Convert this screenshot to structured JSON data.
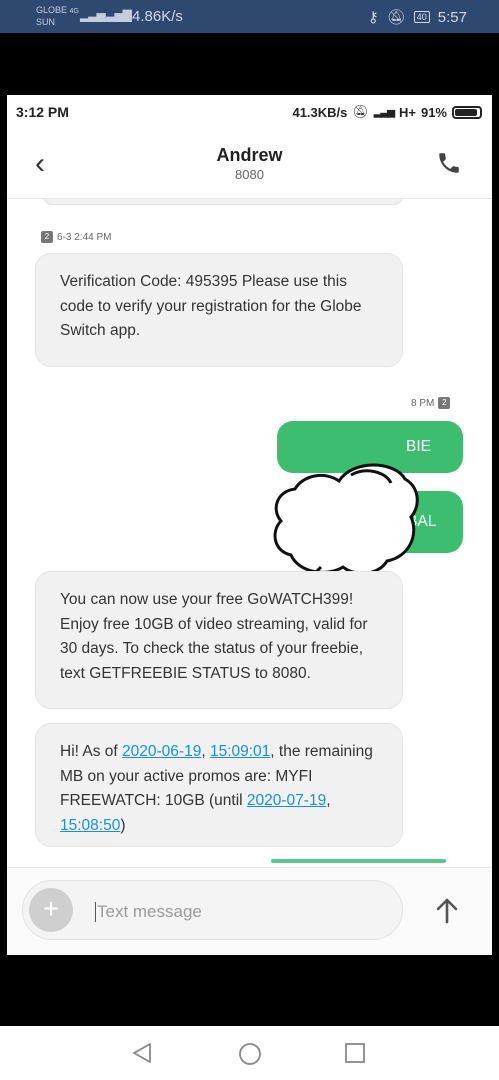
{
  "outer_status": {
    "carrier_line1": "GLOBE",
    "carrier_line2": "SUN",
    "net_type": "4G",
    "speed": "4.86K/s",
    "battery": "40",
    "time": "5:57"
  },
  "inner_status": {
    "time": "3:12 PM",
    "speed": "41.3KB/s",
    "network": "H+",
    "battery": "91%"
  },
  "header": {
    "contact_name": "Andrew",
    "contact_number": "8080"
  },
  "messages": [
    {
      "direction": "incoming",
      "sim": "2",
      "timestamp": "6-3 2:44 PM",
      "text": "Verification Code: 495395 Please use this code to verify your registration for the Globe Switch app."
    },
    {
      "direction": "outgoing",
      "sim": "2",
      "timestamp_partial": "8 PM",
      "text_partial": "BIE"
    },
    {
      "direction": "outgoing",
      "text": "DATA BAL"
    },
    {
      "direction": "incoming",
      "text": "You can now use your free GoWATCH399! Enjoy free 10GB of video streaming, valid for 30 days. To check the status of your freebie, text GETFREEBIE STATUS to 8080."
    },
    {
      "direction": "incoming",
      "parts": {
        "p1": "Hi! As of ",
        "date1": "2020-06-19",
        "comma1": ", ",
        "time1": "15:09:01",
        "p2": ", the remaining MB on your active promos are: MYFI FREEWATCH: 10GB (until ",
        "date2": "2020-07-19",
        "comma2": ", ",
        "time2": "15:08:50",
        "p3": ")"
      }
    }
  ],
  "compose": {
    "placeholder": "Text message"
  },
  "colors": {
    "outgoing_bubble": "#3dbd6f",
    "incoming_bubble": "#f1f1f1",
    "link": "#1a8fd6",
    "outer_status_bg": "#2f4870"
  }
}
